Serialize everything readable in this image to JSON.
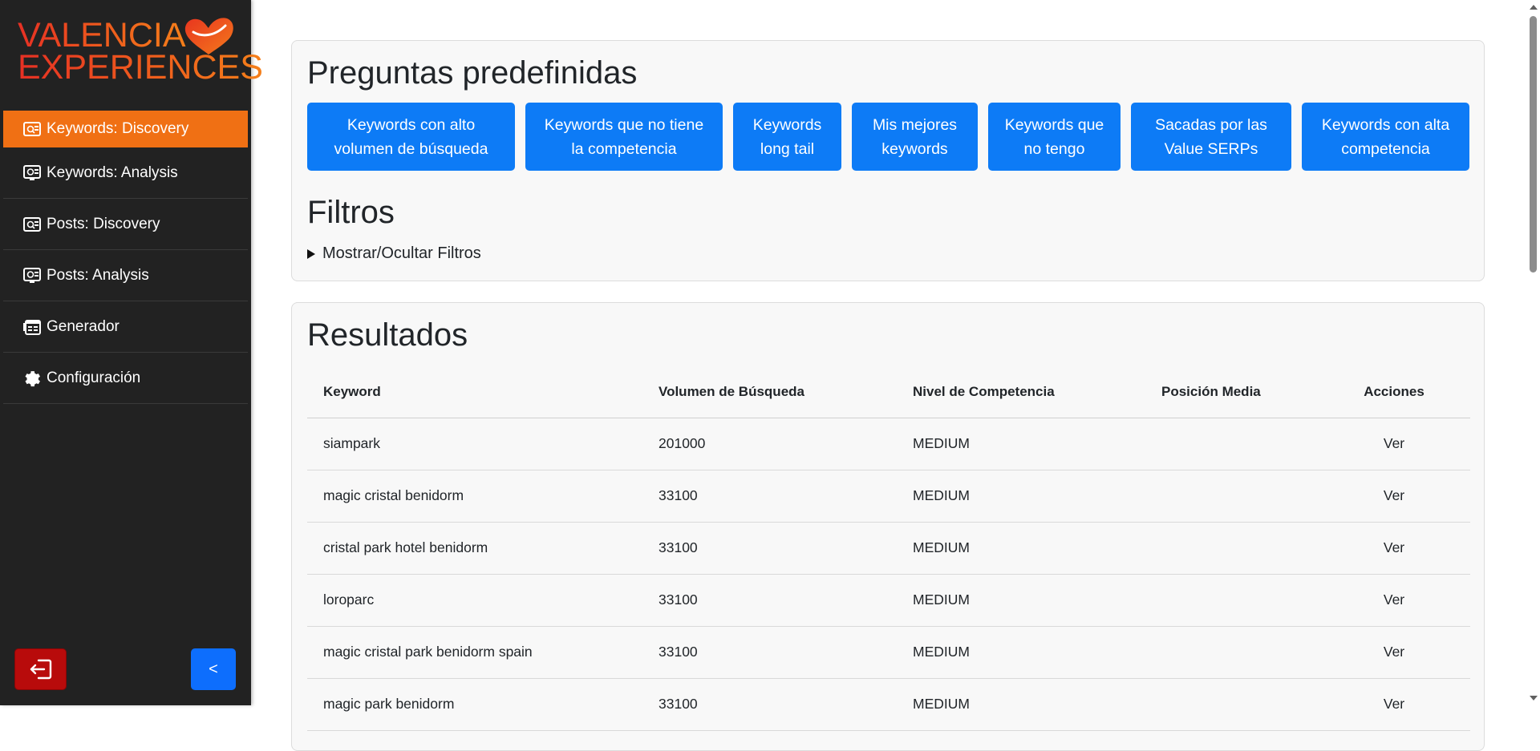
{
  "brand": {
    "line1": "VALENCIA",
    "line2": "EXPERIENCES",
    "heart_color": "#f05a28"
  },
  "sidebar": {
    "items": [
      {
        "label": "Keywords: Discovery",
        "icon": "keywords-discovery-icon",
        "active": true
      },
      {
        "label": "Keywords: Analysis",
        "icon": "keywords-analysis-icon",
        "active": false
      },
      {
        "label": "Posts: Discovery",
        "icon": "posts-discovery-icon",
        "active": false
      },
      {
        "label": "Posts: Analysis",
        "icon": "posts-analysis-icon",
        "active": false
      },
      {
        "label": "Generador",
        "icon": "generator-icon",
        "active": false
      },
      {
        "label": "Configuración",
        "icon": "gear-icon",
        "active": false
      }
    ],
    "collapse_label": "<",
    "logout_icon": "logout-icon"
  },
  "presets": {
    "title": "Preguntas predefinidas",
    "buttons": [
      {
        "line1": "Keywords con alto",
        "line2": "volumen de búsqueda"
      },
      {
        "line1": "Keywords que no tiene",
        "line2": "la competencia"
      },
      {
        "line1": "Keywords",
        "line2": "long tail"
      },
      {
        "line1": "Mis mejores",
        "line2": "keywords"
      },
      {
        "line1": "Keywords que",
        "line2": "no tengo"
      },
      {
        "line1": "Sacadas por las",
        "line2": "Value SERPs"
      },
      {
        "line1": "Keywords con alta",
        "line2": "competencia"
      }
    ]
  },
  "filters": {
    "title": "Filtros",
    "toggle_label": "Mostrar/Ocultar Filtros"
  },
  "results": {
    "title": "Resultados",
    "columns": [
      "Keyword",
      "Volumen de Búsqueda",
      "Nivel de Competencia",
      "Posición Media",
      "Acciones"
    ],
    "rows": [
      {
        "keyword": "siampark",
        "volume": "201000",
        "competition": "MEDIUM",
        "position": "",
        "action": "Ver"
      },
      {
        "keyword": "magic cristal benidorm",
        "volume": "33100",
        "competition": "MEDIUM",
        "position": "",
        "action": "Ver"
      },
      {
        "keyword": "cristal park hotel benidorm",
        "volume": "33100",
        "competition": "MEDIUM",
        "position": "",
        "action": "Ver"
      },
      {
        "keyword": "loroparc",
        "volume": "33100",
        "competition": "MEDIUM",
        "position": "",
        "action": "Ver"
      },
      {
        "keyword": "magic cristal park benidorm spain",
        "volume": "33100",
        "competition": "MEDIUM",
        "position": "",
        "action": "Ver"
      },
      {
        "keyword": "magic park benidorm",
        "volume": "33100",
        "competition": "MEDIUM",
        "position": "",
        "action": "Ver"
      }
    ]
  },
  "colors": {
    "sidebar_bg": "#222222",
    "active_item": "#f07014",
    "primary_button": "#0d7bf6",
    "logout_button": "#b80b0b"
  }
}
